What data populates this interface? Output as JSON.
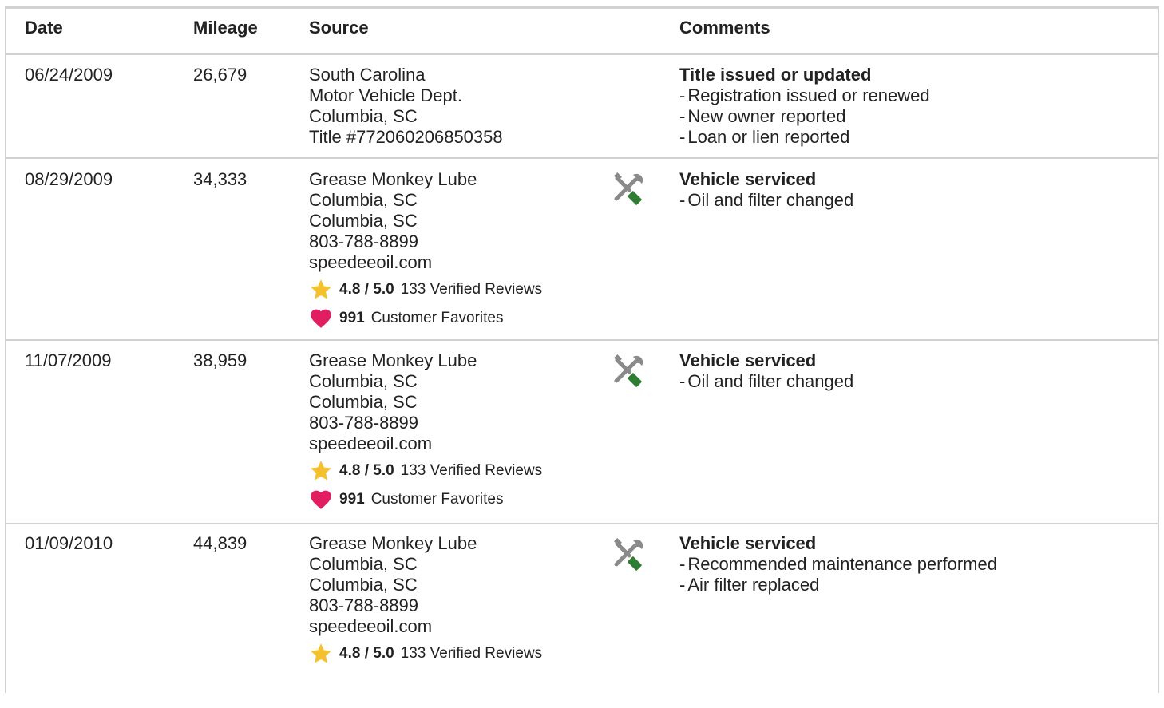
{
  "header": {
    "date": "Date",
    "mileage": "Mileage",
    "source": "Source",
    "comments": "Comments"
  },
  "rows": [
    {
      "date": "06/24/2009",
      "mileage": "26,679",
      "source": [
        "South Carolina",
        "Motor Vehicle Dept.",
        "Columbia, SC",
        "Title #772060206850358"
      ],
      "comment_title": "Title issued or updated",
      "comment_items": [
        "Registration issued or renewed",
        "New owner reported",
        "Loan or lien reported"
      ]
    },
    {
      "date": "08/29/2009",
      "mileage": "34,333",
      "source": [
        "Grease Monkey Lube",
        "Columbia, SC",
        "Columbia, SC",
        "803-788-8899",
        "speedeeoil.com"
      ],
      "rating": "4.8 / 5.0",
      "reviews": "133 Verified Reviews",
      "favorites_count": "991",
      "favorites_label": "Customer Favorites",
      "icon": "service-tools-icon",
      "comment_title": "Vehicle serviced",
      "comment_items": [
        "Oil and filter changed"
      ]
    },
    {
      "date": "11/07/2009",
      "mileage": "38,959",
      "source": [
        "Grease Monkey Lube",
        "Columbia, SC",
        "Columbia, SC",
        "803-788-8899",
        "speedeeoil.com"
      ],
      "rating": "4.8 / 5.0",
      "reviews": "133 Verified Reviews",
      "favorites_count": "991",
      "favorites_label": "Customer Favorites",
      "icon": "service-tools-icon",
      "comment_title": "Vehicle serviced",
      "comment_items": [
        "Oil and filter changed"
      ]
    },
    {
      "date": "01/09/2010",
      "mileage": "44,839",
      "source": [
        "Grease Monkey Lube",
        "Columbia, SC",
        "Columbia, SC",
        "803-788-8899",
        "speedeeoil.com"
      ],
      "rating": "4.8 / 5.0",
      "reviews": "133 Verified Reviews",
      "icon": "service-tools-icon",
      "comment_title": "Vehicle serviced",
      "comment_items": [
        "Recommended maintenance performed",
        "Air filter replaced"
      ]
    }
  ],
  "colors": {
    "star": "#f5c02d",
    "heart": "#e21e63",
    "wrench": "#8a8a8a",
    "screwdriver": "#2e7d32",
    "border": "#d2d2d2"
  }
}
